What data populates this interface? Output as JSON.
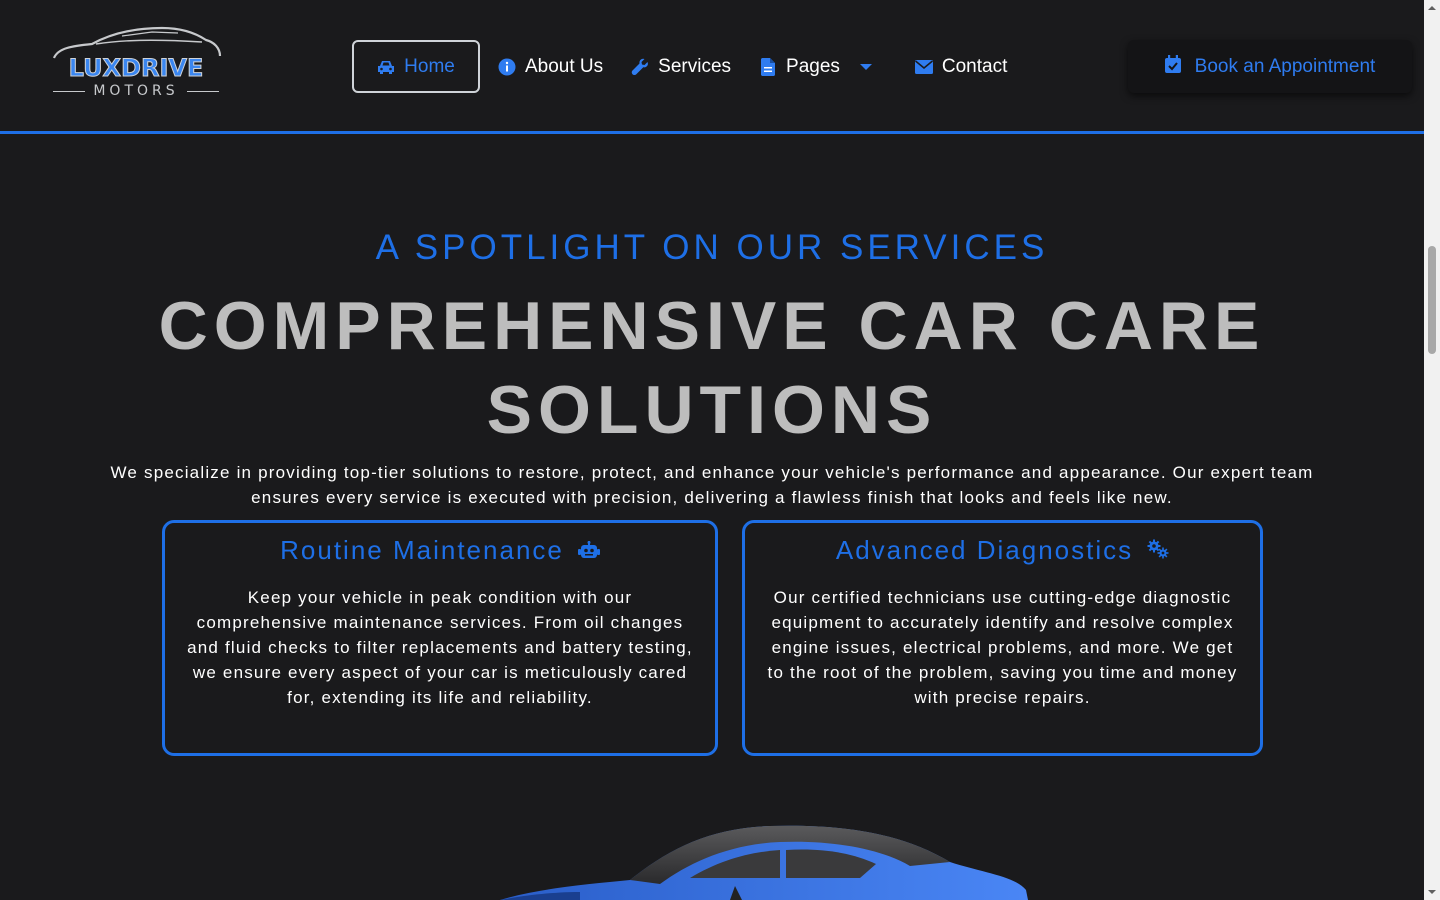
{
  "brand": {
    "name": "LUXDRIVE",
    "sub": "MOTORS"
  },
  "nav": {
    "items": [
      {
        "label": "Home",
        "icon": "car-icon"
      },
      {
        "label": "About Us",
        "icon": "info-icon"
      },
      {
        "label": "Services",
        "icon": "wrench-icon"
      },
      {
        "label": "Pages",
        "icon": "file-icon"
      },
      {
        "label": "Contact",
        "icon": "envelope-icon"
      }
    ],
    "active": "Home",
    "cta": "Book an Appointment"
  },
  "hero": {
    "eyebrow": "A SPOTLIGHT ON OUR SERVICES",
    "title": "COMPREHENSIVE CAR CARE SOLUTIONS",
    "lead": "We specialize in providing top-tier solutions to restore, protect, and enhance your vehicle's performance and appearance. Our expert team ensures every service is executed with precision, delivering a flawless finish that looks and feels like new."
  },
  "services": [
    {
      "title": "Routine Maintenance",
      "icon": "robot-icon",
      "text": "Keep your vehicle in peak condition with our comprehensive maintenance services. From oil changes and fluid checks to filter replacements and battery testing, we ensure every aspect of your car is meticulously cared for, extending its life and reliability."
    },
    {
      "title": "Advanced Diagnostics",
      "icon": "gears-icon",
      "text": "Our certified technicians use cutting-edge diagnostic equipment to accurately identify and resolve complex engine issues, electrical problems, and more. We get to the root of the problem, saving you time and money with precise repairs."
    }
  ],
  "colors": {
    "accent": "#1e6fe6",
    "background": "#1a1a1c",
    "title": "#bdbdbd"
  }
}
